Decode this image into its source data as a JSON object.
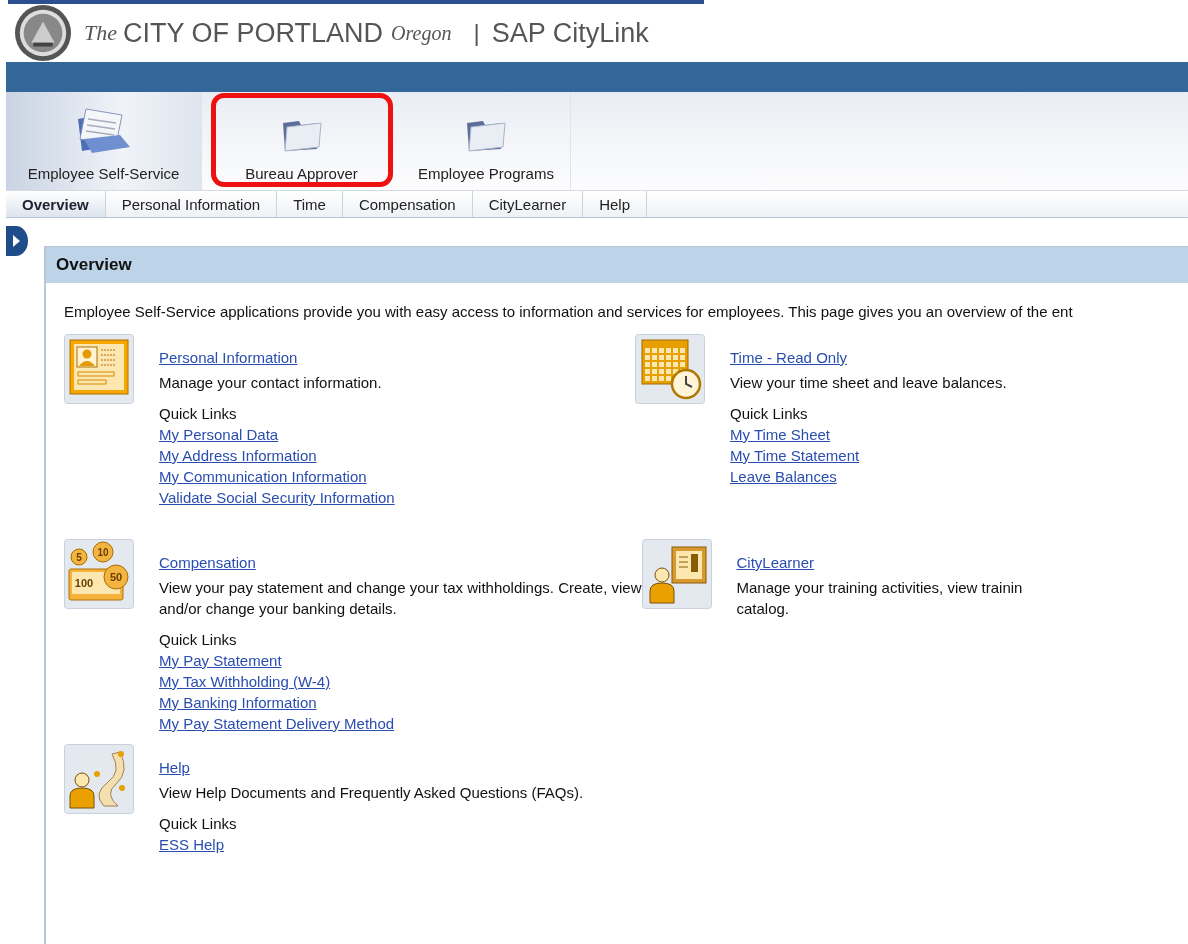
{
  "header": {
    "brand_prefix": "The",
    "brand": "CITY OF PORTLAND",
    "brand_suffix": "Oregon",
    "separator": "|",
    "product": "SAP CityLink"
  },
  "top_nav": [
    {
      "label": "Employee Self-Service",
      "kind": "papers",
      "selected": true,
      "highlighted": false
    },
    {
      "label": "Bureau Approver",
      "kind": "folder",
      "selected": false,
      "highlighted": true
    },
    {
      "label": "Employee Programs",
      "kind": "folder",
      "selected": false,
      "highlighted": false
    }
  ],
  "tabs": [
    {
      "label": "Overview",
      "selected": true
    },
    {
      "label": "Personal Information",
      "selected": false
    },
    {
      "label": "Time",
      "selected": false
    },
    {
      "label": "Compensation",
      "selected": false
    },
    {
      "label": "CityLearner",
      "selected": false
    },
    {
      "label": "Help",
      "selected": false
    }
  ],
  "panel": {
    "title": "Overview",
    "intro": "Employee Self-Service applications provide you with easy access to information and services for employees.  This page gives you an overview of the ent",
    "sections": [
      {
        "kind": "person-card",
        "title": "Personal Information",
        "description": [
          "Manage your contact information."
        ],
        "quick_links_label": "Quick Links",
        "links": [
          "My Personal Data",
          "My Address Information",
          "My Communication Information",
          "Validate Social Security Information"
        ]
      },
      {
        "kind": "calendar",
        "title": "Time - Read Only",
        "description": [
          "View your time sheet and leave balances."
        ],
        "quick_links_label": "Quick Links",
        "links": [
          "My Time Sheet",
          "My Time Statement",
          "Leave Balances"
        ]
      },
      {
        "kind": "coins",
        "coin_labels": [
          "5",
          "10",
          "100",
          "50"
        ],
        "title": "Compensation",
        "description": [
          "View your pay statement and change your tax withholdings.  Create, view",
          "and/or change your banking details."
        ],
        "quick_links_label": "Quick Links",
        "links": [
          "My Pay Statement",
          "My Tax Withholding (W-4)",
          "My Banking Information",
          "My Pay Statement Delivery Method"
        ]
      },
      {
        "kind": "trainer",
        "title": "CityLearner",
        "description": [
          "Manage your training activities, view trainin",
          "catalog."
        ]
      },
      {
        "kind": "road",
        "title": "Help",
        "description": [
          "View Help Documents and Frequently Asked Questions (FAQs)."
        ],
        "quick_links_label": "Quick Links",
        "links": [
          "ESS Help"
        ]
      }
    ]
  }
}
